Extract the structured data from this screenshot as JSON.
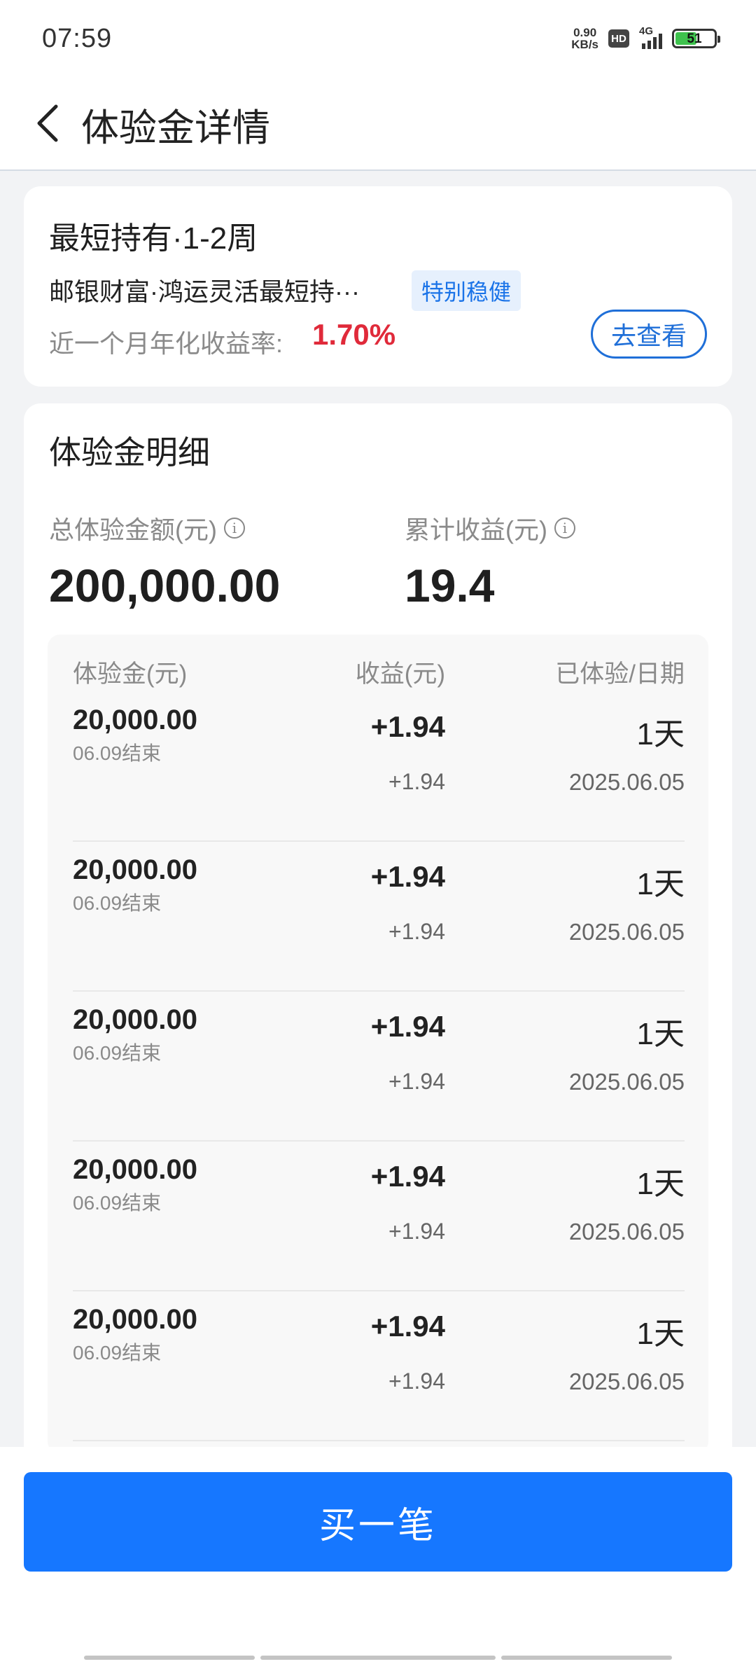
{
  "status_bar": {
    "time": "07:59",
    "net_speed_value": "0.90",
    "net_speed_unit": "KB/s",
    "hd_label": "HD",
    "network_label": "4G",
    "battery_level": "51"
  },
  "header": {
    "title": "体验金详情"
  },
  "product_card": {
    "title": "最短持有·1-2周",
    "product_name": "邮银财富·鸿运灵活最短持···",
    "tag": "特别稳健",
    "rate_label": "近一个月年化收益率:",
    "rate_value": "1.70%",
    "view_button": "去查看"
  },
  "detail_card": {
    "title": "体验金明细",
    "total_label": "总体验金额(元)",
    "total_value": "200,000.00",
    "earnings_label": "累计收益(元)",
    "earnings_value": "19.4",
    "table": {
      "headers": [
        "体验金(元)",
        "收益(元)",
        "已体验/日期"
      ],
      "rows": [
        {
          "amount": "20,000.00",
          "end": "06.09结束",
          "earn": "+1.94",
          "earn_sub": "+1.94",
          "days": "1天",
          "date": "2025.06.05"
        },
        {
          "amount": "20,000.00",
          "end": "06.09结束",
          "earn": "+1.94",
          "earn_sub": "+1.94",
          "days": "1天",
          "date": "2025.06.05"
        },
        {
          "amount": "20,000.00",
          "end": "06.09结束",
          "earn": "+1.94",
          "earn_sub": "+1.94",
          "days": "1天",
          "date": "2025.06.05"
        },
        {
          "amount": "20,000.00",
          "end": "06.09结束",
          "earn": "+1.94",
          "earn_sub": "+1.94",
          "days": "1天",
          "date": "2025.06.05"
        },
        {
          "amount": "20,000.00",
          "end": "06.09结束",
          "earn": "+1.94",
          "earn_sub": "+1.94",
          "days": "1天",
          "date": "2025.06.05"
        }
      ]
    }
  },
  "footer": {
    "buy_button": "买一笔"
  },
  "colors": {
    "accent": "#1677ff",
    "rate_red": "#e02a3a",
    "tag_bg": "#e6f0fd",
    "battery_green": "#3ec24d"
  },
  "icons": [
    "back-arrow-icon",
    "info-icon",
    "hd-icon",
    "signal-icon",
    "battery-icon"
  ]
}
